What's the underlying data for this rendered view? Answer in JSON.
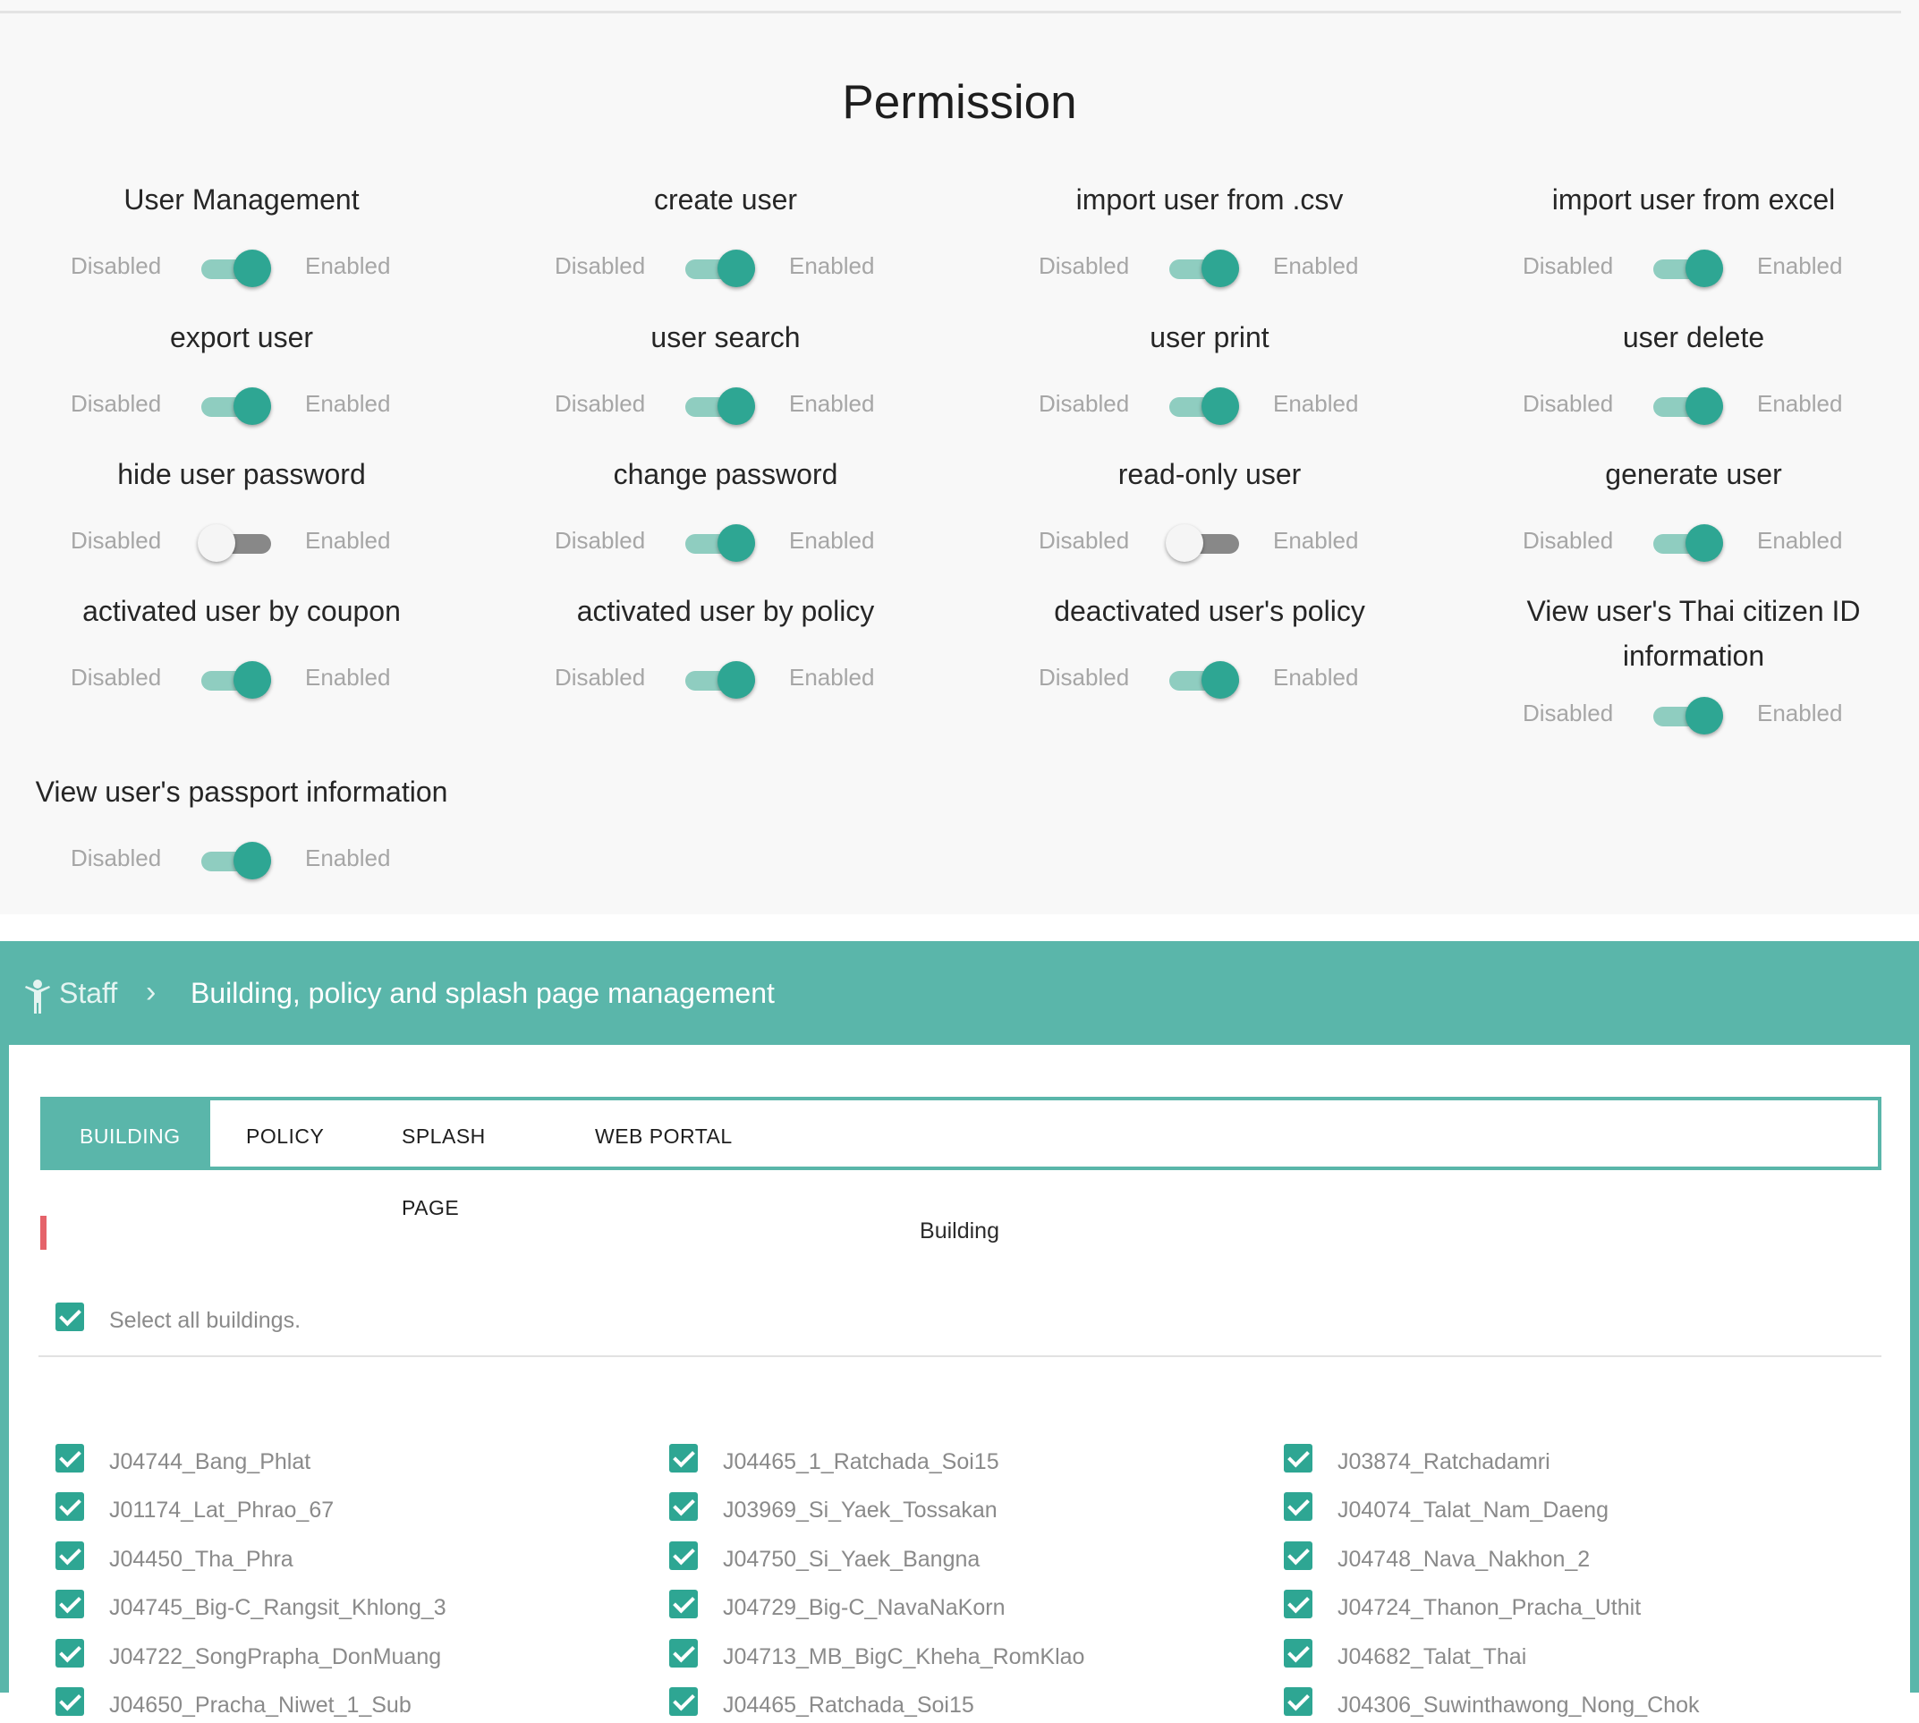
{
  "permission": {
    "title": "Permission",
    "disabled_label": "Disabled",
    "enabled_label": "Enabled",
    "items": [
      {
        "label": "User Management",
        "enabled": true
      },
      {
        "label": "create user",
        "enabled": true
      },
      {
        "label": "import user from .csv",
        "enabled": true
      },
      {
        "label": "import user from excel",
        "enabled": true
      },
      {
        "label": "export user",
        "enabled": true
      },
      {
        "label": "user search",
        "enabled": true
      },
      {
        "label": "user print",
        "enabled": true
      },
      {
        "label": "user delete",
        "enabled": true
      },
      {
        "label": "hide user password",
        "enabled": false
      },
      {
        "label": "change password",
        "enabled": true
      },
      {
        "label": "read-only user",
        "enabled": false
      },
      {
        "label": "generate user",
        "enabled": true
      },
      {
        "label": "activated user by coupon",
        "enabled": true
      },
      {
        "label": "activated user by policy",
        "enabled": true
      },
      {
        "label": "deactivated user's policy",
        "enabled": true
      },
      {
        "label": "View user's Thai citizen ID information",
        "enabled": true
      },
      {
        "label": "View user's passport information",
        "enabled": true
      }
    ]
  },
  "breadcrumb": {
    "root": "Staff",
    "root_icon": "person-icon",
    "separator": ">",
    "current": "Building, policy and splash page management"
  },
  "tabs": [
    {
      "label": "BUILDING",
      "active": true
    },
    {
      "label": "POLICY",
      "active": false
    },
    {
      "label": "SPLASH PAGE",
      "active": false
    },
    {
      "label": "WEB PORTAL",
      "active": false
    }
  ],
  "building_section": {
    "title": "Building",
    "select_all_label": "Select all buildings.",
    "select_all_checked": true,
    "columns": [
      [
        "J04744_Bang_Phlat",
        "J01174_Lat_Phrao_67",
        "J04450_Tha_Phra",
        "J04745_Big-C_Rangsit_Khlong_3",
        "J04722_SongPrapha_DonMuang",
        "J04650_Pracha_Niwet_1_Sub"
      ],
      [
        "J04465_1_Ratchada_Soi15",
        "J03969_Si_Yaek_Tossakan",
        "J04750_Si_Yaek_Bangna",
        "J04729_Big-C_NavaNaKorn",
        "J04713_MB_BigC_Kheha_RomKlao",
        "J04465_Ratchada_Soi15"
      ],
      [
        "J03874_Ratchadamri",
        "J04074_Talat_Nam_Daeng",
        "J04748_Nava_Nakhon_2",
        "J04724_Thanon_Pracha_Uthit",
        "J04682_Talat_Thai",
        "J04306_Suwinthawong_Nong_Chok"
      ]
    ]
  },
  "colors": {
    "accent": "#5ab6aa",
    "switch_on_knob": "#2ea693",
    "switch_on_track": "#8fcdc0",
    "marker": "#e5636a"
  }
}
